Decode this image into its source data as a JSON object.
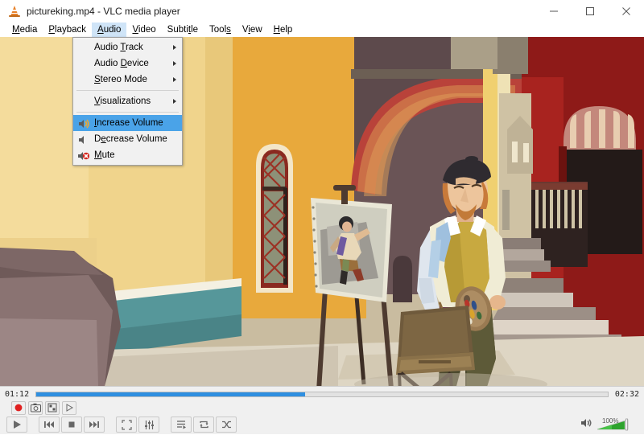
{
  "window": {
    "title": "pictureking.mp4 - VLC media player",
    "app_icon": "vlc-cone-icon",
    "buttons": [
      {
        "name": "minimize",
        "glyph": "minimize-icon"
      },
      {
        "name": "maximize",
        "glyph": "maximize-icon"
      },
      {
        "name": "close",
        "glyph": "close-icon"
      }
    ]
  },
  "menubar": {
    "items": [
      {
        "label": "Media",
        "accel": "M",
        "active": false
      },
      {
        "label": "Playback",
        "accel": "P",
        "active": false
      },
      {
        "label": "Audio",
        "accel": "A",
        "active": true
      },
      {
        "label": "Video",
        "accel": "V",
        "active": false
      },
      {
        "label": "Subtitle",
        "accel": "t",
        "active": false
      },
      {
        "label": "Tools",
        "accel": "s",
        "active": false
      },
      {
        "label": "View",
        "accel": "i",
        "active": false
      },
      {
        "label": "Help",
        "accel": "H",
        "active": false
      }
    ]
  },
  "audio_menu": {
    "open": true,
    "items": [
      {
        "label": "Audio Track",
        "accel": "T",
        "submenu": true,
        "icon": null,
        "highlighted": false,
        "separator_after": false
      },
      {
        "label": "Audio Device",
        "accel": "D",
        "submenu": true,
        "icon": null,
        "highlighted": false,
        "separator_after": false
      },
      {
        "label": "Stereo Mode",
        "accel": "S",
        "submenu": true,
        "icon": null,
        "highlighted": false,
        "separator_after": true
      },
      {
        "label": "Visualizations",
        "accel": "V",
        "submenu": true,
        "icon": null,
        "highlighted": false,
        "separator_after": true
      },
      {
        "label": "Increase Volume",
        "accel": "I",
        "submenu": false,
        "icon": "volume-up-icon",
        "highlighted": true,
        "separator_after": false
      },
      {
        "label": "Decrease Volume",
        "accel": "e",
        "submenu": false,
        "icon": "volume-down-icon",
        "highlighted": false,
        "separator_after": false
      },
      {
        "label": "Mute",
        "accel": "M",
        "submenu": false,
        "icon": "mute-icon",
        "highlighted": false,
        "separator_after": false
      }
    ]
  },
  "player": {
    "elapsed": "01:12",
    "total": "02:32",
    "progress_percent": 47,
    "seek_fill_color": "#2f8fe0",
    "volume_percent": "100%",
    "volume_color": "#28a428",
    "extended_buttons": [
      {
        "name": "record-button",
        "icon": "record-icon"
      },
      {
        "name": "snapshot-button",
        "icon": "camera-icon"
      },
      {
        "name": "ab-loop-button",
        "icon": "ab-loop-icon"
      },
      {
        "name": "frame-by-frame-button",
        "icon": "frame-step-icon"
      }
    ],
    "transport_buttons": [
      {
        "name": "play-button",
        "icon": "play-icon"
      },
      {
        "name": "previous-button",
        "icon": "previous-icon"
      },
      {
        "name": "stop-button",
        "icon": "stop-icon"
      },
      {
        "name": "next-button",
        "icon": "next-icon"
      },
      {
        "name": "fullscreen-button",
        "icon": "fullscreen-icon"
      },
      {
        "name": "extended-settings-button",
        "icon": "equalizer-icon"
      },
      {
        "name": "playlist-button",
        "icon": "playlist-icon"
      },
      {
        "name": "loop-button",
        "icon": "loop-icon"
      },
      {
        "name": "random-button",
        "icon": "shuffle-icon"
      }
    ]
  },
  "video_scene": {
    "description": "Animated painting of a street artist at an easel in an old European alley",
    "palette": {
      "wall_yellow": "#e8c87a",
      "wall_gold": "#e6a93f",
      "wall_teal": "#5c9a9a",
      "pavement": "#cfc6b4",
      "arch_red": "#a8231f",
      "dark_arch": "#5d4a4c",
      "sky": "#c9bca0"
    }
  }
}
